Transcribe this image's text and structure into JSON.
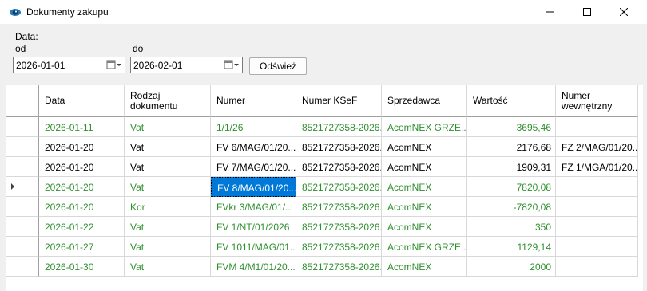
{
  "window": {
    "title": "Dokumenty zakupu",
    "icon": "app-eye-icon"
  },
  "filters": {
    "data_label": "Data:",
    "from_label": "od",
    "to_label": "do",
    "from_value": "2026-01-01",
    "to_value": "2026-02-01",
    "refresh_label": "Odśwież"
  },
  "grid": {
    "columns": [
      "Data",
      "Rodzaj\ndokumentu",
      "Numer",
      "Numer KSeF",
      "Sprzedawca",
      "Wartość",
      "Numer\nwewnętrzny"
    ],
    "current_row_index": 3,
    "rows": [
      {
        "data": "2026-01-11",
        "rodzaj": "Vat",
        "numer": "1/1/26",
        "ksef": "8521727358-2026...",
        "sprzedawca": "AcomNEX  GRZE...",
        "wartosc": "3695,46",
        "wewn": "",
        "color": "green"
      },
      {
        "data": "2026-01-20",
        "rodzaj": "Vat",
        "numer": "FV 6/MAG/01/20...",
        "ksef": "8521727358-2026...",
        "sprzedawca": "AcomNEX",
        "wartosc": "2176,68",
        "wewn": "FZ 2/MAG/01/20...",
        "color": "black"
      },
      {
        "data": "2026-01-20",
        "rodzaj": "Vat",
        "numer": "FV 7/MAG/01/20...",
        "ksef": "8521727358-2026...",
        "sprzedawca": "AcomNEX",
        "wartosc": "1909,31",
        "wewn": "FZ 1/MGA/01/20...",
        "color": "black"
      },
      {
        "data": "2026-01-20",
        "rodzaj": "Vat",
        "numer": "FV 8/MAG/01/20...",
        "ksef": "8521727358-2026...",
        "sprzedawca": "AcomNEX",
        "wartosc": "7820,08",
        "wewn": "",
        "color": "green"
      },
      {
        "data": "2026-01-20",
        "rodzaj": "Kor",
        "numer": "FVkr 3/MAG/01/...",
        "ksef": "8521727358-2026...",
        "sprzedawca": "AcomNEX",
        "wartosc": "-7820,08",
        "wewn": "",
        "color": "green"
      },
      {
        "data": "2026-01-22",
        "rodzaj": "Vat",
        "numer": "FV 1/NT/01/2026",
        "ksef": "8521727358-2026...",
        "sprzedawca": "AcomNEX",
        "wartosc": "350",
        "wewn": "",
        "color": "green"
      },
      {
        "data": "2026-01-27",
        "rodzaj": "Vat",
        "numer": "FV 1011/MAG/01...",
        "ksef": "8521727358-2026...",
        "sprzedawca": "AcomNEX  GRZE...",
        "wartosc": "1129,14",
        "wewn": "",
        "color": "green"
      },
      {
        "data": "2026-01-30",
        "rodzaj": "Vat",
        "numer": "FVM 4/M1/01/20...",
        "ksef": "8521727358-2026...",
        "sprzedawca": "AcomNEX",
        "wartosc": "2000",
        "wewn": "",
        "color": "green"
      }
    ]
  },
  "colors": {
    "green_text": "#2f8f2f",
    "selection": "#0078d7"
  }
}
